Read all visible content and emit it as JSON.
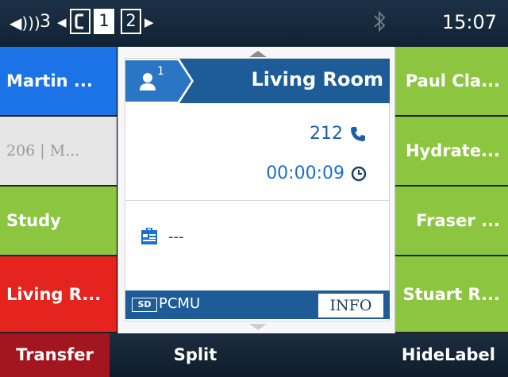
{
  "statusbar": {
    "volume_icon": "speaker-icon",
    "line_count": "3",
    "prev_arrow": "◀",
    "next_arrow": "▶",
    "pages": [
      "1",
      "2"
    ],
    "active_page": "1",
    "bluetooth_icon": "bluetooth-icon",
    "time": "15:07"
  },
  "linekeys_left": [
    {
      "label": "Martin ...",
      "color": "#1c73e8"
    },
    {
      "label": "206 | M...",
      "color": "#e6e6e6"
    },
    {
      "label": "Study",
      "color": "#8cc640"
    },
    {
      "label": "Living R...",
      "color": "#e5241f"
    }
  ],
  "linekeys_right": [
    {
      "label": "Paul Cla...",
      "color": "#8cc640"
    },
    {
      "label": "Hydrate...",
      "color": "#8cc640"
    },
    {
      "label": "Fraser ...",
      "color": "#8cc640"
    },
    {
      "label": "Stuart R...",
      "color": "#8cc640"
    }
  ],
  "call": {
    "line_badge": "1",
    "contact_name": "Living Room",
    "number": "212",
    "duration": "00:00:09",
    "contact_info": "---",
    "codec_badge": "SD",
    "codec": "PCMU",
    "info_button": "INFO",
    "header_color": "#1e5c98"
  },
  "softkeys": [
    "Transfer",
    "Split",
    "HideLabel"
  ]
}
